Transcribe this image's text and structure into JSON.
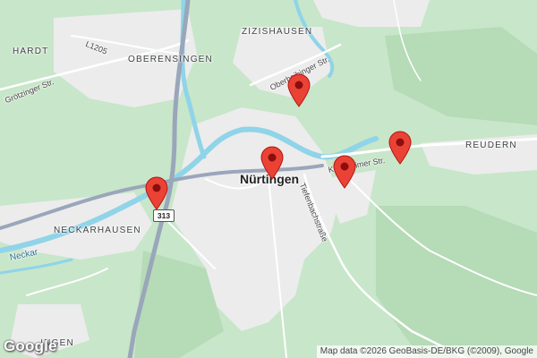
{
  "map": {
    "place_labels": {
      "hardt": "HARDT",
      "zizishausen": "ZIZISHAUSEN",
      "oberensingen": "OBERENSINGEN",
      "neckarhausen": "NECKARHAUSEN",
      "reudern": "REUDERN",
      "bottom_partial": "…INGEN"
    },
    "city_label": "Nürtingen",
    "street_labels": {
      "l1205": "L1205",
      "grotzinger": "Grötzinger Str.",
      "oberboihinger": "Oberboihinger Str.",
      "kirchheimer": "Kirchheimer Str.",
      "tiefenbach": "Tiefenbachstraße"
    },
    "water_labels": {
      "neckar": "Neckar"
    },
    "road_shield": "313",
    "markers": [
      {
        "name": "marker-1",
        "label": ""
      },
      {
        "name": "marker-2",
        "label": ""
      },
      {
        "name": "marker-3",
        "label": ""
      },
      {
        "name": "marker-4",
        "label": ""
      },
      {
        "name": "marker-5",
        "label": ""
      }
    ],
    "colors": {
      "forest": "#bfe0bf",
      "urban": "#ececec",
      "water": "#8fd4e8",
      "motorway": "#9aa6ba",
      "marker": "#ea4335"
    }
  },
  "branding": {
    "logo": "Google",
    "attribution": "Map data ©2026 GeoBasis-DE/BKG (©2009), Google"
  }
}
